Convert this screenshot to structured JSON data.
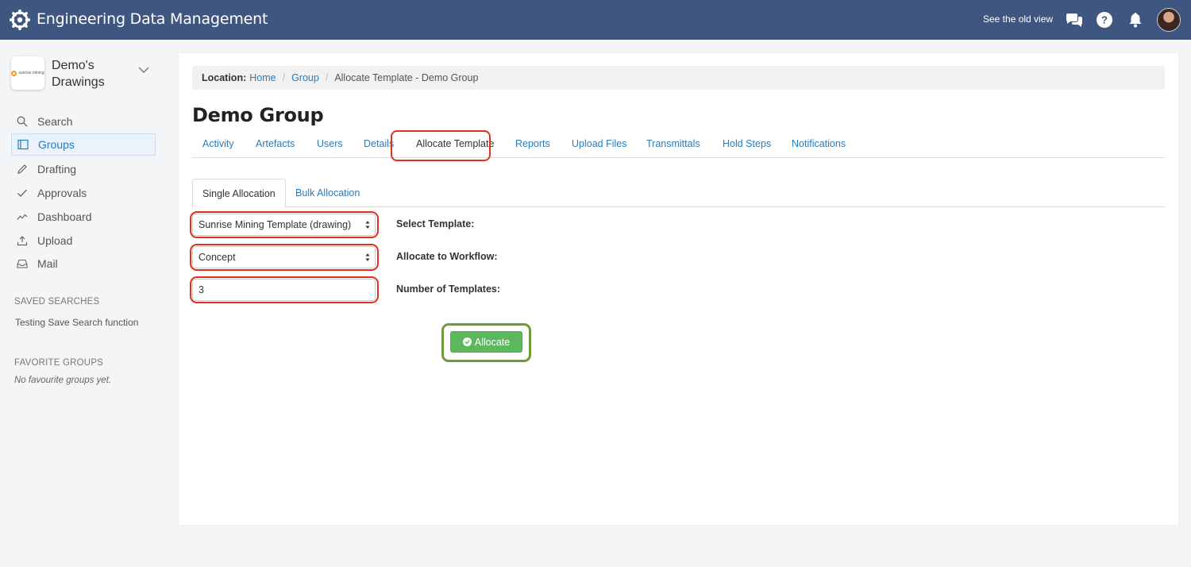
{
  "app": {
    "title": "Engineering Data Management",
    "old_view_label": "See the old view"
  },
  "colors": {
    "header_bg": "#3f5680",
    "link": "#2b7bb9",
    "highlight_red": "#e0311d",
    "highlight_green": "#6f9a3a",
    "success": "#5cb85c"
  },
  "header_icons": [
    "gear-logo-icon",
    "chat-icon",
    "help-icon",
    "bell-icon",
    "avatar"
  ],
  "sidebar": {
    "workspace_name": "Demo's Drawings",
    "workspace_logo_text": "sunrise mining",
    "items": [
      {
        "label": "Search",
        "icon": "search-icon",
        "active": false
      },
      {
        "label": "Groups",
        "icon": "book-icon",
        "active": true
      },
      {
        "label": "Drafting",
        "icon": "pencil-icon",
        "active": false
      },
      {
        "label": "Approvals",
        "icon": "checkmark-icon",
        "active": false
      },
      {
        "label": "Dashboard",
        "icon": "line-chart-icon",
        "active": false
      },
      {
        "label": "Upload",
        "icon": "upload-icon",
        "active": false
      },
      {
        "label": "Mail",
        "icon": "inbox-icon",
        "active": false
      }
    ],
    "saved_searches_heading": "SAVED SEARCHES",
    "saved_searches": [
      "Testing Save Search function"
    ],
    "favorite_groups_heading": "FAVORITE GROUPS",
    "favorite_groups_empty": "No favourite groups yet."
  },
  "breadcrumb": {
    "label": "Location:",
    "items": [
      "Home",
      "Group"
    ],
    "current": "Allocate Template - Demo Group"
  },
  "page_title": "Demo Group",
  "tabs": [
    {
      "label": "Activity",
      "active": false
    },
    {
      "label": "Artefacts",
      "active": false
    },
    {
      "label": "Users",
      "active": false
    },
    {
      "label": "Details",
      "active": false
    },
    {
      "label": "Allocate Template",
      "active": true
    },
    {
      "label": "Reports",
      "active": false
    },
    {
      "label": "Upload Files",
      "active": false
    },
    {
      "label": "Transmittals",
      "active": false
    },
    {
      "label": "Hold Steps",
      "active": false
    },
    {
      "label": "Notifications",
      "active": false
    }
  ],
  "subtabs": [
    {
      "label": "Single Allocation",
      "active": true
    },
    {
      "label": "Bulk Allocation",
      "active": false
    }
  ],
  "form": {
    "template": {
      "value": "Sunrise Mining Template (drawing)",
      "label": "Select Template:"
    },
    "workflow": {
      "value": "Concept",
      "label": "Allocate to Workflow:"
    },
    "count": {
      "value": "3",
      "label": "Number of Templates:"
    },
    "submit_label": "Allocate"
  }
}
